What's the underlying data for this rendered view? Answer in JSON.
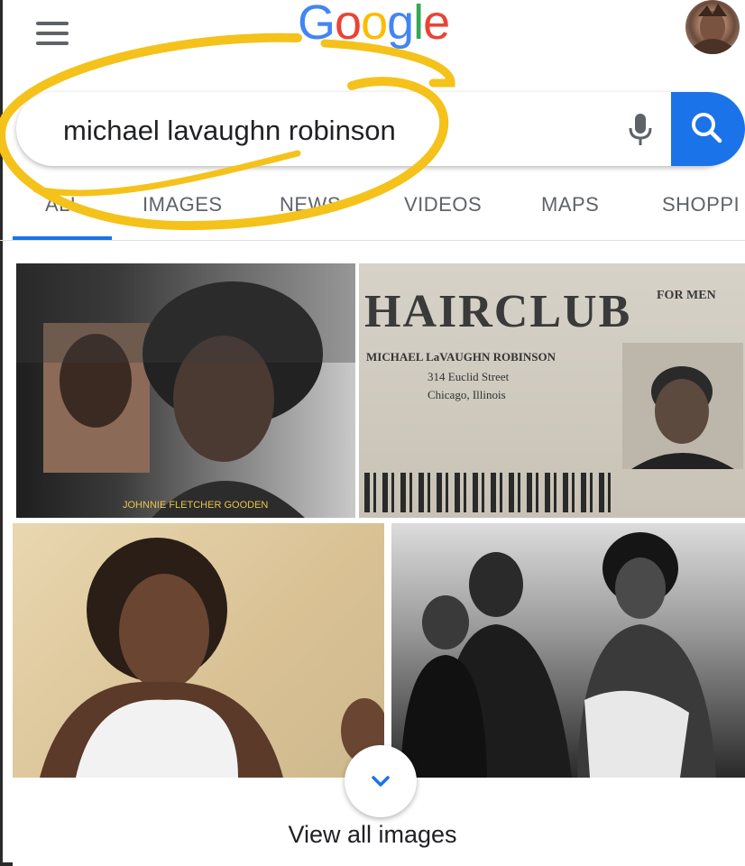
{
  "header": {
    "logo_letters": [
      {
        "char": "G",
        "color": "#4285f4"
      },
      {
        "char": "o",
        "color": "#ea4335"
      },
      {
        "char": "o",
        "color": "#fbbc05"
      },
      {
        "char": "g",
        "color": "#4285f4"
      },
      {
        "char": "l",
        "color": "#34a853"
      },
      {
        "char": "e",
        "color": "#ea4335"
      }
    ],
    "menu_icon": "hamburger-icon",
    "avatar_icon": "profile-avatar"
  },
  "search": {
    "query": "michael lavaughn robinson",
    "mic_icon": "microphone-icon",
    "button_icon": "magnifier-icon",
    "button_color": "#1a73e8"
  },
  "tabs": [
    "ALL",
    "IMAGES",
    "NEWS",
    "VIDEOS",
    "MAPS",
    "SHOPPI"
  ],
  "active_tab": "ALL",
  "annotation_color": "#f4c21a",
  "images": {
    "id_card": {
      "brand": "HAIRCLUB",
      "tagline": "FOR MEN",
      "name": "MICHAEL LaVAUGHN ROBINSON",
      "street": "314 Euclid Street",
      "city": "Chicago, Illinois"
    },
    "collage_caption": "JOHNNIE FLETCHER GOODEN"
  },
  "footer": {
    "expand_icon": "chevron-down-icon",
    "view_all_label": "View all images"
  }
}
